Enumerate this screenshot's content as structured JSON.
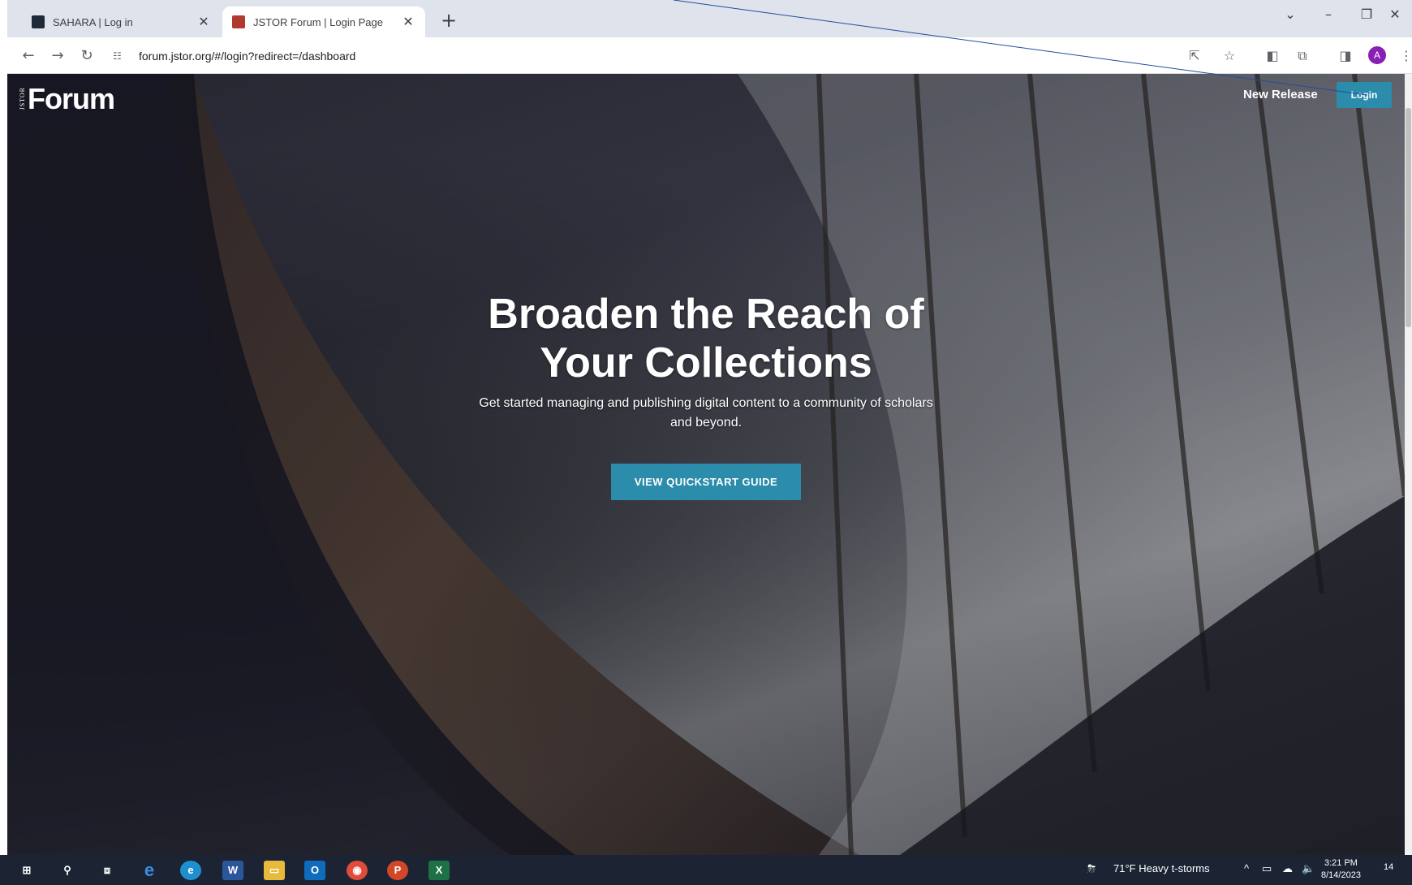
{
  "browser": {
    "tabs": [
      {
        "title": "SAHARA | Log in",
        "active": false,
        "favicon_color": "#1f2937"
      },
      {
        "title": "JSTOR Forum | Login Page",
        "active": true,
        "favicon_color": "#b03a2e"
      }
    ],
    "new_tab_label": "+",
    "url": "forum.jstor.org/#/login?redirect=/dashboard",
    "profile_initial": "A"
  },
  "page": {
    "logo_small": "JSTOR",
    "logo_big": "Forum",
    "nav": {
      "new_release": "New Release",
      "login": "Login"
    },
    "hero": {
      "title": "Broaden the Reach of Your Collections",
      "subtitle": "Get started managing and publishing digital content to a community of scholars and beyond.",
      "cta": "VIEW QUICKSTART GUIDE"
    },
    "accent_color": "#2b8cab"
  },
  "taskbar": {
    "weather": "71°F  Heavy t-storms",
    "time": "3:21 PM",
    "date": "8/14/2023",
    "notification_count": "14"
  }
}
